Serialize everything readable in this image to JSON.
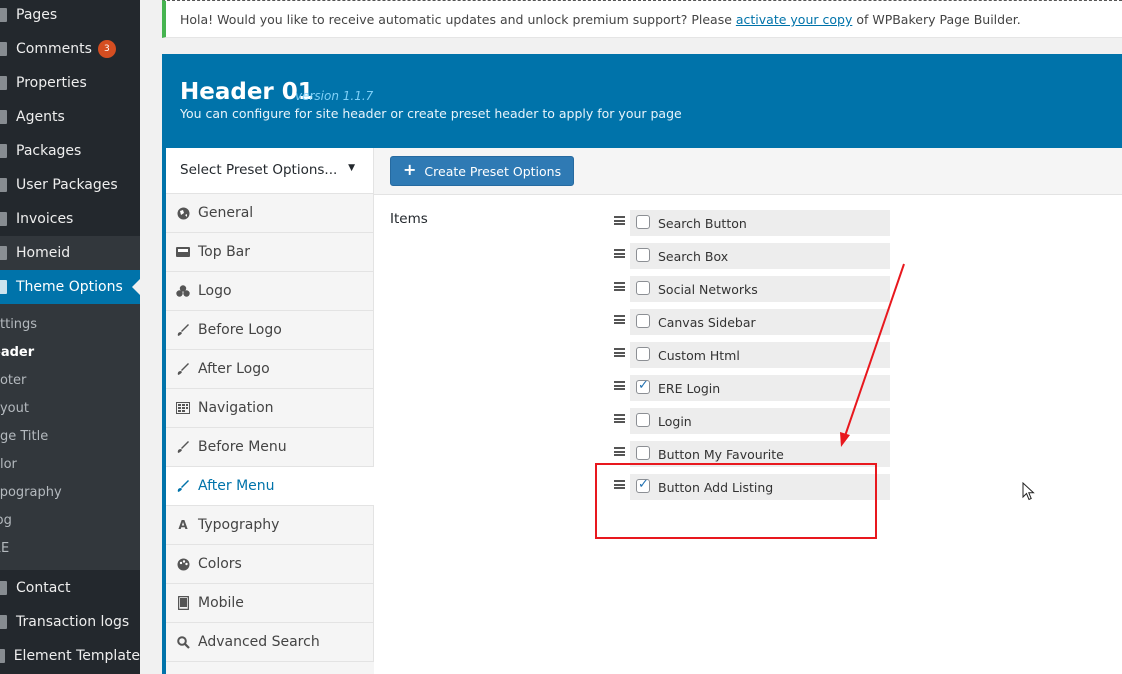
{
  "sidebar": {
    "items": [
      {
        "label": "Pages"
      },
      {
        "label": "Comments",
        "badge": "3"
      },
      {
        "label": "Properties"
      },
      {
        "label": "Agents"
      },
      {
        "label": "Packages"
      },
      {
        "label": "User Packages"
      },
      {
        "label": "Invoices"
      },
      {
        "label": "Homeid"
      },
      {
        "label": "Theme Options"
      }
    ],
    "submenu": [
      {
        "label": "ettings"
      },
      {
        "label": "eader"
      },
      {
        "label": "ooter"
      },
      {
        "label": "ayout"
      },
      {
        "label": "age Title"
      },
      {
        "label": "olor"
      },
      {
        "label": "ypography"
      },
      {
        "label": "log"
      },
      {
        "label": "RE"
      }
    ],
    "bottom_items": [
      {
        "label": "Contact"
      },
      {
        "label": "Transaction logs"
      },
      {
        "label": "Element Template"
      }
    ]
  },
  "notice": {
    "prefix": "Hola! Would you like to receive automatic updates and unlock premium support? Please ",
    "link": "activate your copy",
    "suffix": " of WPBakery Page Builder."
  },
  "panel": {
    "title": "Header 01",
    "version": "version 1.1.7",
    "description": "You can configure for site header or create preset header to apply for your page"
  },
  "preset": {
    "select_label": "Select Preset Options...",
    "create_button": "Create Preset Options"
  },
  "sections": [
    {
      "label": "General",
      "icon": "globe-icon"
    },
    {
      "label": "Top Bar",
      "icon": "inbox-icon"
    },
    {
      "label": "Logo",
      "icon": "cubes-icon"
    },
    {
      "label": "Before Logo",
      "icon": "brush-icon"
    },
    {
      "label": "After Logo",
      "icon": "brush-icon"
    },
    {
      "label": "Navigation",
      "icon": "calendar-grid-icon"
    },
    {
      "label": "Before Menu",
      "icon": "brush-icon"
    },
    {
      "label": "After Menu",
      "icon": "brush-icon",
      "active": true
    },
    {
      "label": "Typography",
      "icon": "font-icon"
    },
    {
      "label": "Colors",
      "icon": "palette-icon"
    },
    {
      "label": "Mobile",
      "icon": "tablet-icon"
    },
    {
      "label": "Advanced Search",
      "icon": "search-icon"
    }
  ],
  "items_field": {
    "label": "Items",
    "options": [
      {
        "label": "Search Button",
        "checked": false
      },
      {
        "label": "Search Box",
        "checked": false
      },
      {
        "label": "Social Networks",
        "checked": false
      },
      {
        "label": "Canvas Sidebar",
        "checked": false
      },
      {
        "label": "Custom Html",
        "checked": false
      },
      {
        "label": "ERE Login",
        "checked": true
      },
      {
        "label": "Login",
        "checked": false
      },
      {
        "label": "Button My Favourite",
        "checked": false
      },
      {
        "label": "Button Add Listing",
        "checked": true
      }
    ]
  },
  "colors": {
    "accent": "#0073aa",
    "admin_bg": "#23282d",
    "annotation": "#e8181e"
  }
}
